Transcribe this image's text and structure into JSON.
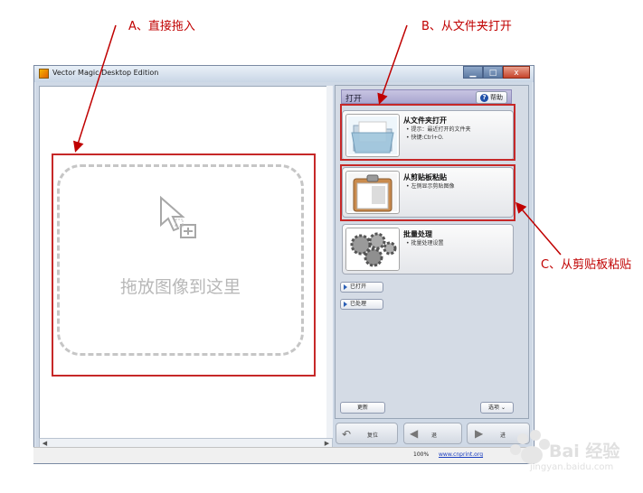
{
  "annotations": {
    "a": "A、直接拖入",
    "b": "B、从文件夹打开",
    "c": "C、从剪贴板粘贴"
  },
  "window": {
    "title": "Vector Magic Desktop Edition",
    "minimize": "▁",
    "maximize": "□",
    "close": "x"
  },
  "dropzone": {
    "text": "拖放图像到这里"
  },
  "panel": {
    "title": "打开",
    "help": "帮助",
    "actions": [
      {
        "title": "从文件夹打开",
        "bullets": [
          "提示：最近打开的文件夹",
          "快键:Ctrl+O."
        ]
      },
      {
        "title": "从剪贴板粘贴",
        "bullets": [
          "左侧显示剪贴图像"
        ]
      },
      {
        "title": "批量处理",
        "bullets": [
          "批量处理设置"
        ]
      }
    ],
    "opened": "已打开",
    "processed": "已处理",
    "update": "更新",
    "options": "选项"
  },
  "nav": {
    "reset": "复位",
    "back": "退",
    "forward": "进"
  },
  "status": {
    "zoom": "100%",
    "site": "www.cnprint.org"
  },
  "watermark": {
    "brand": "Bai 经验",
    "url": "jingyan.baidu.com"
  }
}
